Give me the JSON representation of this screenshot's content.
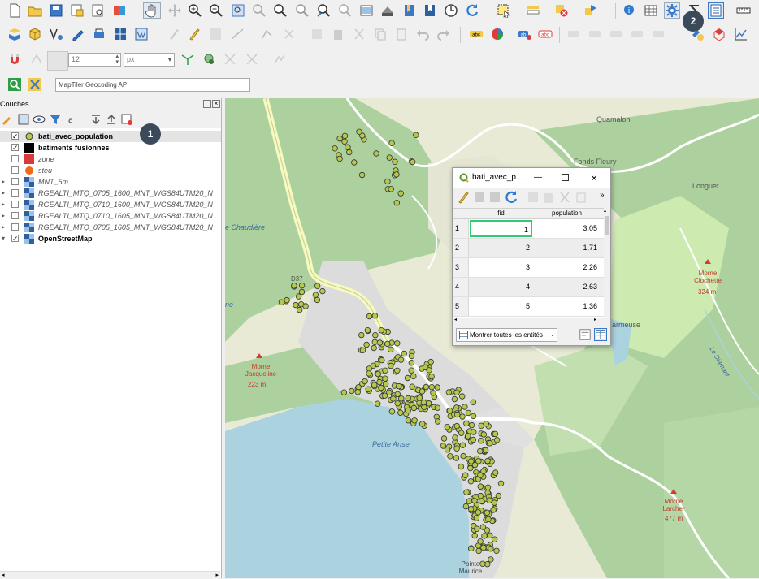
{
  "toolbar": {
    "search_placeholder": "MapTiler Geocoding API",
    "size_value": "12",
    "unit_value": "px"
  },
  "layers_panel": {
    "title": "Couches",
    "layers": [
      {
        "label": "bati_avec_population",
        "checked": true,
        "bold": true,
        "underline": true,
        "symbol": "green-point"
      },
      {
        "label": "batiments fusionnes",
        "checked": true,
        "bold": true,
        "symbol": "black-square"
      },
      {
        "label": "zone",
        "checked": false,
        "italic": true,
        "symbol": "red-square"
      },
      {
        "label": "steu",
        "checked": false,
        "italic": true,
        "symbol": "orange-point"
      },
      {
        "label": "MNT_5m",
        "checked": false,
        "italic": true,
        "symbol": "raster"
      },
      {
        "label": "RGEALTI_MTQ_0705_1600_MNT_WGS84UTM20_N",
        "checked": false,
        "italic": true,
        "symbol": "raster"
      },
      {
        "label": "RGEALTI_MTQ_0710_1600_MNT_WGS84UTM20_N",
        "checked": false,
        "italic": true,
        "symbol": "raster"
      },
      {
        "label": "RGEALTI_MTQ_0710_1605_MNT_WGS84UTM20_N",
        "checked": false,
        "italic": true,
        "symbol": "raster"
      },
      {
        "label": "RGEALTI_MTQ_0705_1605_MNT_WGS84UTM20_N",
        "checked": false,
        "italic": true,
        "symbol": "raster"
      },
      {
        "label": "OpenStreetMap",
        "checked": true,
        "bold": true,
        "symbol": "raster"
      }
    ]
  },
  "attribute_table": {
    "title": "bati_avec_p...",
    "columns": [
      "fid",
      "population"
    ],
    "rows": [
      {
        "num": "1",
        "fid": "1",
        "population": "3,05"
      },
      {
        "num": "2",
        "fid": "2",
        "population": "1,71"
      },
      {
        "num": "3",
        "fid": "3",
        "population": "2,26"
      },
      {
        "num": "4",
        "fid": "4",
        "population": "2,63"
      },
      {
        "num": "5",
        "fid": "5",
        "population": "1,36"
      }
    ],
    "show_all_label": "Montrer toutes les entités"
  },
  "map": {
    "labels": {
      "quamalon": "Quamalon",
      "fonds_fleury": "Fonds Fleury",
      "longuet": "Longuet",
      "chaudiere": "e Chaudière",
      "morne_clochette": "Morne Clochette",
      "morne_clochette_alt": "324 m",
      "morne_jacqueline": "Morne Jacqueline",
      "morne_jacqueline_alt": "223 m",
      "morne_larcher": "Morne Larcher",
      "morne_larcher_alt": "477 m",
      "petite_anse": "Petite Anse",
      "pointe_maurice": "Pointe Maurice",
      "d37": "D37",
      "armeuse": "armeuse",
      "ne": "ne",
      "le_diamant": "Le Diamant"
    }
  },
  "badges": {
    "one": "1",
    "two": "2"
  },
  "colors": {
    "point_fill": "#b5c84e",
    "point_stroke": "#333333",
    "sea": "#aad3df",
    "forest": "#add19e",
    "grass": "#cdebb0",
    "urban": "#dcdcdc"
  }
}
